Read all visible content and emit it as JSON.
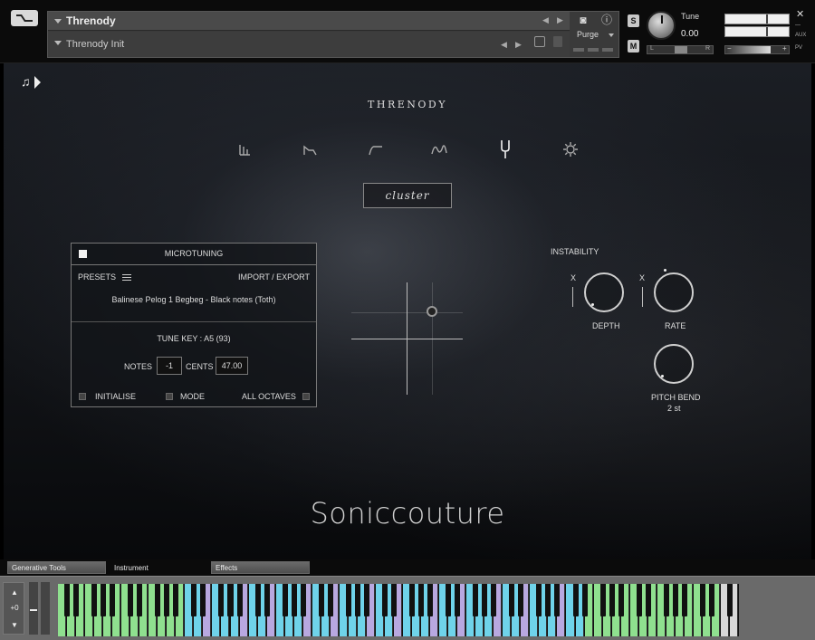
{
  "header": {
    "instrument_name": "Threnody",
    "preset_name": "Threnody Init",
    "purge_label": "Purge",
    "solo_label": "S",
    "mute_label": "M",
    "tune_label": "Tune",
    "tune_value": "0.00",
    "pan_left": "L",
    "pan_right": "R",
    "close_label": "✕",
    "aux_label": "AUX",
    "pv_label": "PV",
    "meter_min": "−",
    "meter_plus": "+"
  },
  "main": {
    "title": "THRENODY",
    "mode_label": "cluster",
    "nav_icons": [
      "bars-icon",
      "envelope-icon",
      "filter-icon",
      "wave-icon",
      "tuning-fork-icon",
      "gear-icon"
    ],
    "active_nav": "tuning-fork-icon",
    "brand": "Soniccouture"
  },
  "microtuning": {
    "title": "MICROTUNING",
    "enabled": true,
    "presets_label": "PRESETS",
    "import_export_label": "IMPORT / EXPORT",
    "scale_name": "Balinese Pelog 1 Begbeg - Black notes (Toth)",
    "tune_key": "TUNE KEY : A5  (93)",
    "notes_label": "NOTES",
    "notes_value": "-1",
    "cents_label": "CENTS",
    "cents_value": "47.00",
    "initialise_label": "INITIALISE",
    "mode_label": "MODE",
    "all_octaves_label": "ALL OCTAVES"
  },
  "instability": {
    "title": "INSTABILITY",
    "x_label": "X",
    "depth_label": "DEPTH",
    "rate_label": "RATE",
    "pitch_bend_label": "PITCH BEND",
    "pitch_bend_value": "2 st"
  },
  "tabs": [
    {
      "label": "Generative Tools",
      "active": false
    },
    {
      "label": "Instrument",
      "active": true
    },
    {
      "label": "Effects",
      "active": false
    }
  ],
  "keyboard": {
    "octave_label": "+0",
    "white_key_colors": {
      "green": "#8fe08f",
      "blue": "#6fd3ea",
      "lavender": "#b8a8e0",
      "grey": "#d8d8d8"
    }
  },
  "colors": {
    "background": "#121418",
    "panel_border": "#777777",
    "text": "#dddddd"
  }
}
